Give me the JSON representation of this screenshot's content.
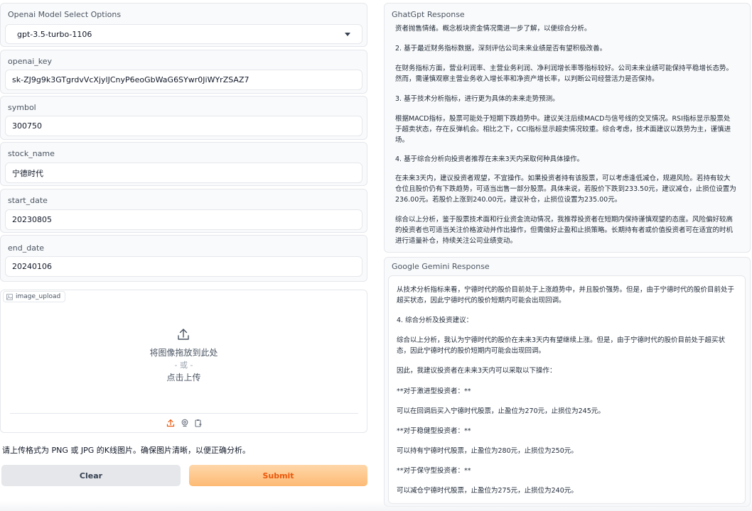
{
  "model_select": {
    "label": "Openai Model Select Options",
    "value": "gpt-3.5-turbo-1106"
  },
  "openai_key": {
    "label": "openai_key",
    "value": "sk-ZJ9g9k3GTgrdvVcXjylJCnyP6eoGbWaG6SYwr0JiWYrZSAZ7"
  },
  "symbol": {
    "label": "symbol",
    "value": "300750"
  },
  "stock_name": {
    "label": "stock_name",
    "value": "宁德时代"
  },
  "start_date": {
    "label": "start_date",
    "value": "20230805"
  },
  "end_date": {
    "label": "end_date",
    "value": "20240106"
  },
  "image_upload": {
    "label": "image_upload",
    "drop_text": "将图像拖放到此处",
    "or_text": "- 或 -",
    "click_text": "点击上传",
    "icons": [
      "upload-icon",
      "webcam-icon",
      "clipboard-icon"
    ]
  },
  "hint": "请上传格式为 PNG 或 JPG 的K线图片。确保图片清晰，以便正确分析。",
  "buttons": {
    "clear": "Clear",
    "submit": "Submit"
  },
  "chatgpt": {
    "label": "GhatGpt Response",
    "paragraphs": [
      "资者抛售情绪。概念板块资金情况需进一步了解，以便综合分析。",
      "2. 基于最近财务指标数据，深刻评估公司未来业绩是否有望积极改善。",
      "在财务指标方面，营业利润率、主营业务利润、净利润增长率等指标较好。公司未来业绩可能保持平稳增长态势。然而，需谨慎观察主营业务收入增长率和净资产增长率，以判断公司经营活力是否保持。",
      "3. 基于技术分析指标，进行更为具体的未来走势预测。",
      "根据MACD指标，股票可能处于短期下跌趋势中。建议关注后续MACD与信号线的交叉情况。RSI指标显示股票处于超卖状态，存在反弹机会。相比之下，CCI指标显示超卖情况较重。综合考虑，技术面建议以跌势为主，谨慎进场。",
      "4. 基于综合分析向投资者推荐在未来3天内采取何种具体操作。",
      "在未来3天内，建议投资者观望，不宜操作。如果投资者持有该股票，可以考虑逢低减仓，规避风险。若持有较大仓位且股价仍有下跌趋势，可适当出售一部分股票。具体来说，若股价下跌到233.50元，建议减仓，止损位设置为236.00元。若股价上涨到240.00元，建议补仓，止损位设置为235.00元。",
      "综合以上分析，鉴于股票技术面和行业资金流动情况，我推荐投资者在短期内保持谨慎观望的态度。风险偏好较高的投资者也可适当关注价格波动并作出操作，但需做好止盈和止损策略。长期持有者或价值投资者可在适宜的时机进行适量补仓，持续关注公司业绩变动。"
    ]
  },
  "gemini": {
    "label": "Google Gemini Response",
    "paragraphs": [
      "从技术分析指标来看，宁德时代的股价目前处于上涨趋势中，并且股价强势。但是，由于宁德时代的股价目前处于超买状态，因此宁德时代的股价短期内可能会出现回调。",
      "4. 综合分析及投资建议：",
      "综合以上分析，我认为宁德时代的股价在未来3天内有望继续上涨。但是，由于宁德时代的股价目前处于超买状态，因此宁德时代的股价短期内可能会出现回调。",
      "因此，我建议投资者在未来3天内可以采取以下操作：",
      "**对于激进型投资者：**",
      "可以在回调后买入宁德时代股票，止盈位为270元，止损位为245元。",
      "**对于稳健型投资者：**",
      "可以持有宁德时代股票，止盈位为280元，止损位为250元。",
      "**对于保守型投资者：**",
      "可以减仓宁德时代股票，止盈位为275元，止损位为240元。"
    ]
  }
}
